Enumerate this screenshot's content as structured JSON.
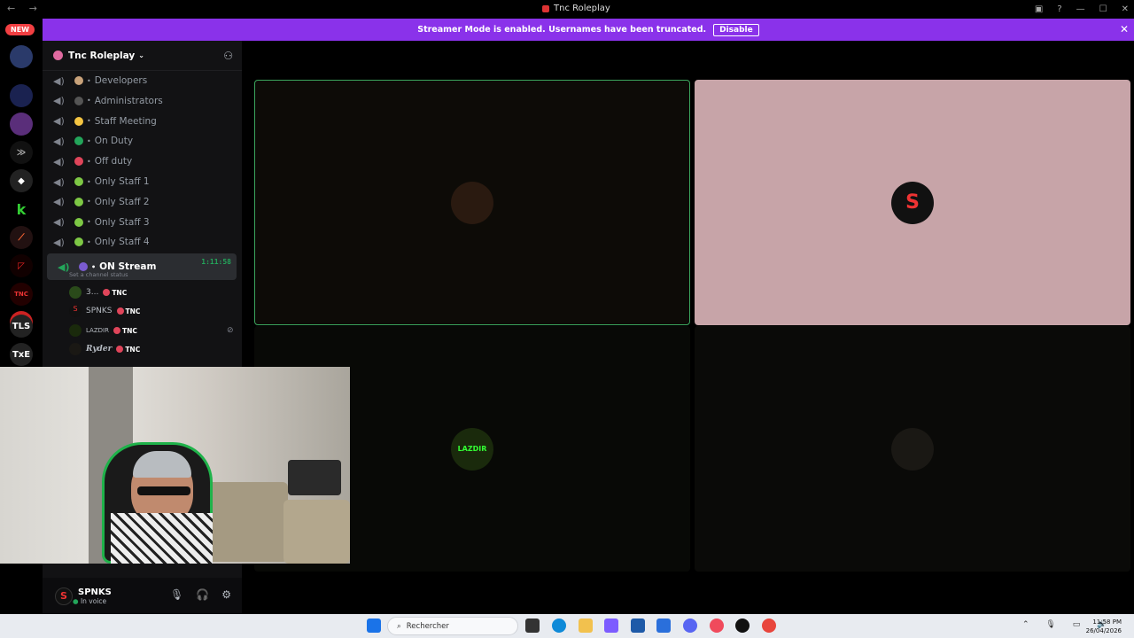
{
  "window": {
    "title": "Tnc Roleplay"
  },
  "banner": {
    "text": "Streamer Mode is enabled. Usernames have been truncated.",
    "button": "Disable"
  },
  "rail": {
    "new_badge": "NEW",
    "mention_count": "85",
    "servers": [
      "TLS",
      "TxE"
    ]
  },
  "guild": {
    "name": "Tnc Roleplay"
  },
  "channels": [
    {
      "name": "Developers",
      "emoji_color": "#c8a27a"
    },
    {
      "name": "Administrators",
      "emoji_color": "#555"
    },
    {
      "name": "Staff Meeting",
      "emoji_color": "#f5c542"
    },
    {
      "name": "On Duty",
      "emoji_color": "#23a55a"
    },
    {
      "name": "Off duty",
      "emoji_color": "#e0455a"
    },
    {
      "name": "Only Staff 1",
      "emoji_color": "#7ec845"
    },
    {
      "name": "Only Staff 2",
      "emoji_color": "#7ec845"
    },
    {
      "name": "Only Staff 3",
      "emoji_color": "#7ec845"
    },
    {
      "name": "Only Staff 4",
      "emoji_color": "#7ec845"
    }
  ],
  "active_channel": {
    "name": "ON Stream",
    "timer": "1:11:58",
    "status_hint": "Set a channel status"
  },
  "members": [
    {
      "name": "3...",
      "tag": "TNC"
    },
    {
      "name": "SPNKS",
      "tag": "TNC"
    },
    {
      "name": "LAZDIR",
      "tag": "TNC"
    },
    {
      "name": "Ryder",
      "tag": "TNC"
    }
  ],
  "user": {
    "name": "SPNKS",
    "status": "In voice"
  },
  "tiles": [
    {
      "label": "",
      "bg": "#0d0b07",
      "border": "#3ba55d",
      "avatar_color": "#2a1a10"
    },
    {
      "label": "",
      "bg": "#c7a4a8",
      "border": "none",
      "avatar_color": "#111111"
    },
    {
      "label": "LAZDIR",
      "bg": "#080906",
      "border": "none",
      "avatar_color": "#1a2a0c"
    },
    {
      "label": "",
      "bg": "#0a0a08",
      "border": "none",
      "avatar_color": "#1a1814"
    }
  ],
  "taskbar": {
    "search_placeholder": "Rechercher",
    "time": "11:58 PM",
    "date": "26/04/2026"
  }
}
